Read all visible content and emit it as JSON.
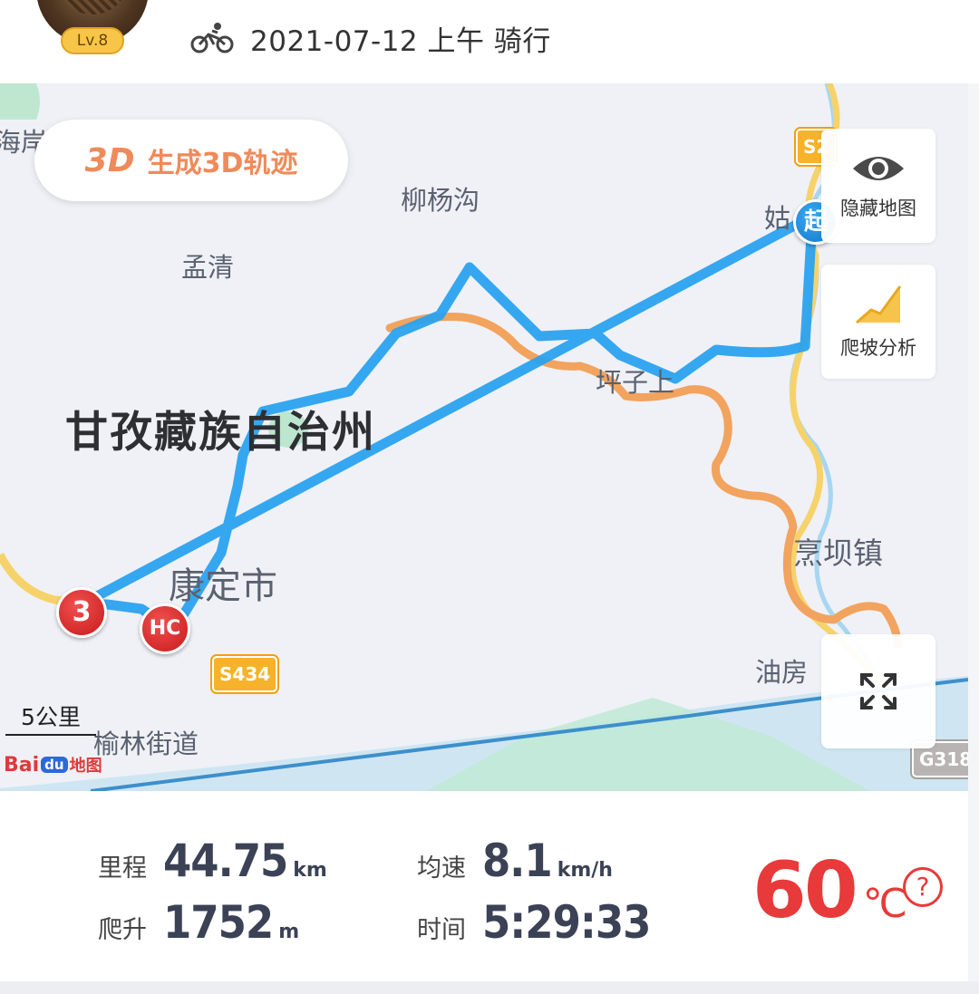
{
  "header": {
    "level": "Lv.8",
    "ride_info": "2021-07-12 上午 骑行",
    "activity_icon": "bicycle-icon"
  },
  "map": {
    "generate_3d": {
      "badge": "3D",
      "label": "生成3D轨迹"
    },
    "side_buttons": [
      {
        "label": "隐藏地图",
        "icon": "eye-icon"
      },
      {
        "label": "爬坡分析",
        "icon": "climb-chart-icon"
      },
      {
        "label": "",
        "icon": "fullscreen-icon"
      }
    ],
    "places": {
      "haian": "海岸",
      "liuyanggou": "柳杨沟",
      "mengqing": "孟清",
      "ganzi": "甘孜藏族自治州",
      "pingzishang": "坪子上",
      "kangding": "康定市",
      "pengbazhen": "烹坝镇",
      "youfang": "油房",
      "yulin": "榆林街道",
      "gu": "姑"
    },
    "road_signs": {
      "s2": "S2",
      "s434": "S434",
      "g318": "G318"
    },
    "markers": {
      "start": "起",
      "lap3": "3",
      "hc": "HC"
    },
    "scale": "5公里",
    "logo": {
      "part1": "Bai",
      "part2": "du",
      "part3": "地图"
    },
    "colors": {
      "track": "#2aa2ef",
      "road": "#f2a35e",
      "river": "#9ad0f0"
    }
  },
  "stats": {
    "distance": {
      "label": "里程",
      "value": "44.75",
      "unit": "km"
    },
    "avg_speed": {
      "label": "均速",
      "value": "8.1",
      "unit": "km/h"
    },
    "climb": {
      "label": "爬升",
      "value": "1752",
      "unit": "m"
    },
    "time": {
      "label": "时间",
      "value": "5:29:33"
    },
    "temperature": {
      "value": "60",
      "unit": "℃"
    },
    "help": "?"
  }
}
